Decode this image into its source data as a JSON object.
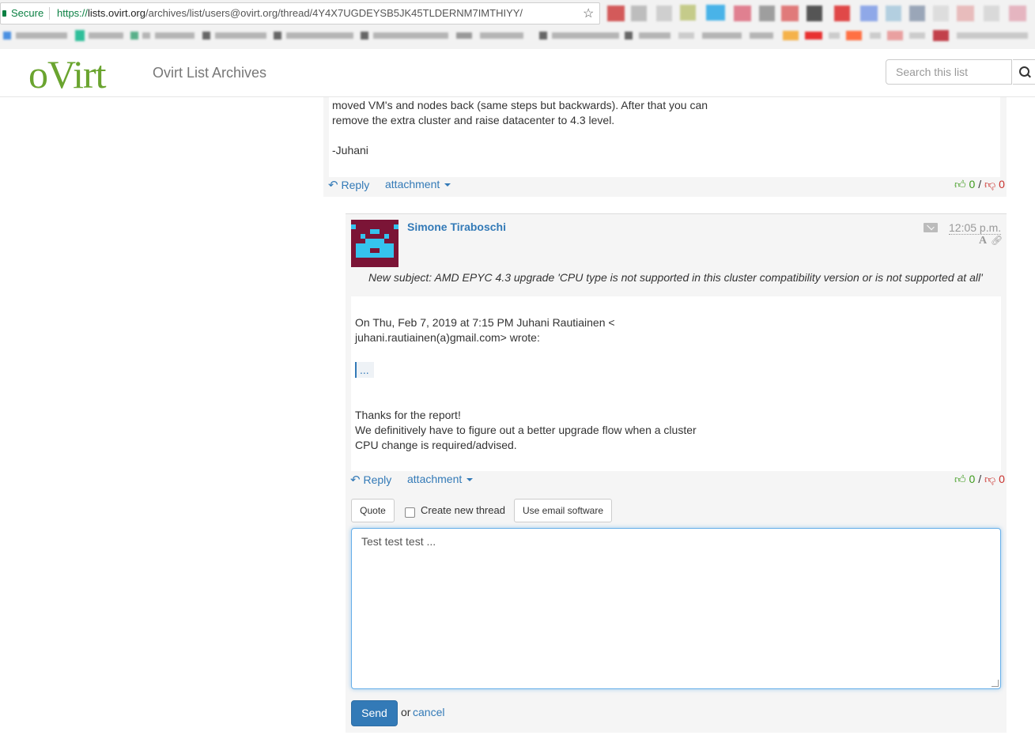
{
  "browser": {
    "secure_label": "Secure",
    "url_scheme": "https://",
    "url_host": "lists.ovirt.org",
    "url_path": "/archives/list/users@ovirt.org/thread/4Y4X7UGDEYSB5JK45TLDERNM7IMTHIYY/",
    "star_icon": "star-icon"
  },
  "header": {
    "logo_text": "oVirt",
    "list_title": "Ovirt List Archives",
    "search_placeholder": "Search this list",
    "search_icon": "search-icon"
  },
  "email1": {
    "lines": [
      "moved VM's and nodes back (same steps but backwards). After that you can",
      "remove the extra cluster and raise datacenter to 4.3 level.",
      "-Juhani"
    ],
    "reply_label": "Reply",
    "attachment_label": "attachment",
    "likes": "0",
    "separator": "/",
    "dislikes": "0"
  },
  "email2": {
    "author": "Simone Tiraboschi",
    "time": "12:05 p.m.",
    "font_icon_glyph": "A",
    "subject": "New subject: AMD EPYC 4.3 upgrade 'CPU type is not supported in this cluster compatibility version or is not supported at all'",
    "body_lines": [
      "On Thu, Feb 7, 2019 at 7:15 PM Juhani Rautiainen <",
      "juhani.rautiainen(a)gmail.com> wrote:",
      "Thanks for the report!",
      "We definitively have to figure out a better upgrade flow when a cluster",
      "CPU change is required/advised."
    ],
    "quote_ellipsis": "...",
    "reply_label": "Reply",
    "attachment_label": "attachment",
    "likes": "0",
    "separator": "/",
    "dislikes": "0"
  },
  "reply_form": {
    "quote_button": "Quote",
    "new_thread_label": "Create new thread",
    "new_thread_checked": false,
    "email_software_button": "Use email software",
    "textarea_value": "Test test test ...",
    "send_button": "Send",
    "or_text": "or",
    "cancel_link": "cancel"
  },
  "colors": {
    "link": "#337ab7",
    "logo_green": "#6aa42f",
    "like_green": "#3c9a1b",
    "dislike_red": "#c9302c",
    "avatar_bg": "#7b1436",
    "avatar_fg": "#35c3ee"
  }
}
